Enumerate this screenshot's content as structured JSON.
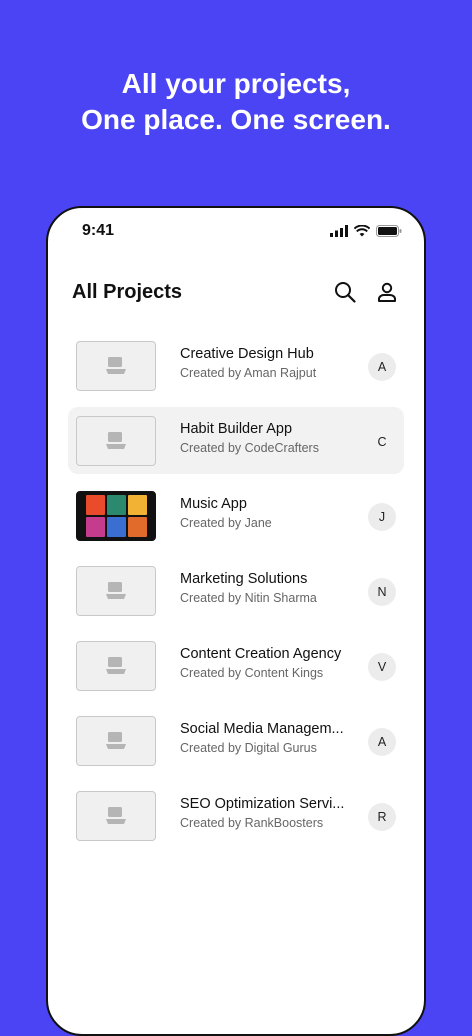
{
  "headline": {
    "line1": "All your projects,",
    "line2": "One place. One screen."
  },
  "status_bar": {
    "time": "9:41",
    "icons": [
      "signal-icon",
      "wifi-icon",
      "battery-icon"
    ]
  },
  "header": {
    "title": "All Projects",
    "actions": [
      "search-icon",
      "profile-icon"
    ]
  },
  "projects": [
    {
      "name": "Creative Design Hub",
      "author": "Created by Aman Rajput",
      "avatar": "A",
      "selected": false,
      "thumbnail": "placeholder"
    },
    {
      "name": "Habit Builder App",
      "author": "Created by CodeCrafters",
      "avatar": "C",
      "selected": true,
      "thumbnail": "placeholder"
    },
    {
      "name": "Music App",
      "author": "Created by Jane",
      "avatar": "J",
      "selected": false,
      "thumbnail": "music-covers"
    },
    {
      "name": "Marketing Solutions",
      "author": "Created by Nitin Sharma",
      "avatar": "N",
      "selected": false,
      "thumbnail": "placeholder"
    },
    {
      "name": "Content Creation Agency",
      "author": "Created by Content Kings",
      "avatar": "V",
      "selected": false,
      "thumbnail": "placeholder"
    },
    {
      "name": "Social Media Managem...",
      "author": "Created by Digital Gurus",
      "avatar": "A",
      "selected": false,
      "thumbnail": "placeholder"
    },
    {
      "name": "SEO Optimization Servi...",
      "author": "Created by RankBoosters",
      "avatar": "R",
      "selected": false,
      "thumbnail": "placeholder"
    }
  ],
  "colors": {
    "background": "#4a44f5",
    "selected_row": "#f2f2f2",
    "avatar_bg": "#ececec"
  }
}
